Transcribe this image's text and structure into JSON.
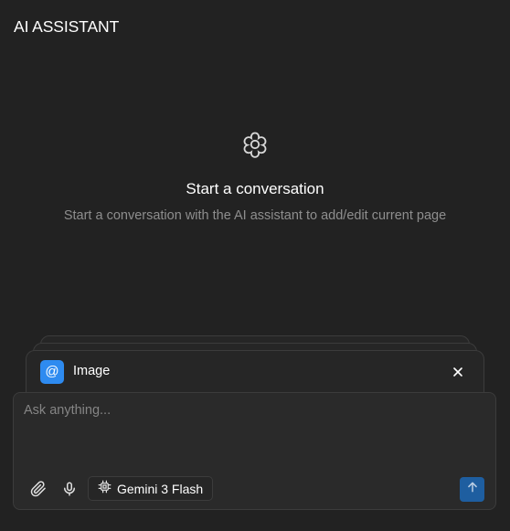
{
  "header": {
    "title": "AI ASSISTANT"
  },
  "empty_state": {
    "icon": "flower-icon",
    "title": "Start a conversation",
    "subtitle": "Start a conversation with the AI assistant to add/edit current page"
  },
  "context": {
    "badge_icon": "at-sign-icon",
    "badge_text": "@",
    "label": "Image",
    "close_icon": "close-icon"
  },
  "composer": {
    "placeholder": "Ask anything...",
    "value": "",
    "attach_icon": "paperclip-icon",
    "mic_icon": "microphone-icon",
    "model_icon": "chip-icon",
    "model_label": "Gemini 3 Flash",
    "send_icon": "arrow-up-icon"
  },
  "colors": {
    "background": "#222222",
    "accent": "#2e8bf0",
    "send_button": "#1e5ea0",
    "muted_text": "#8e8e8e",
    "border": "#3c3c3c"
  }
}
